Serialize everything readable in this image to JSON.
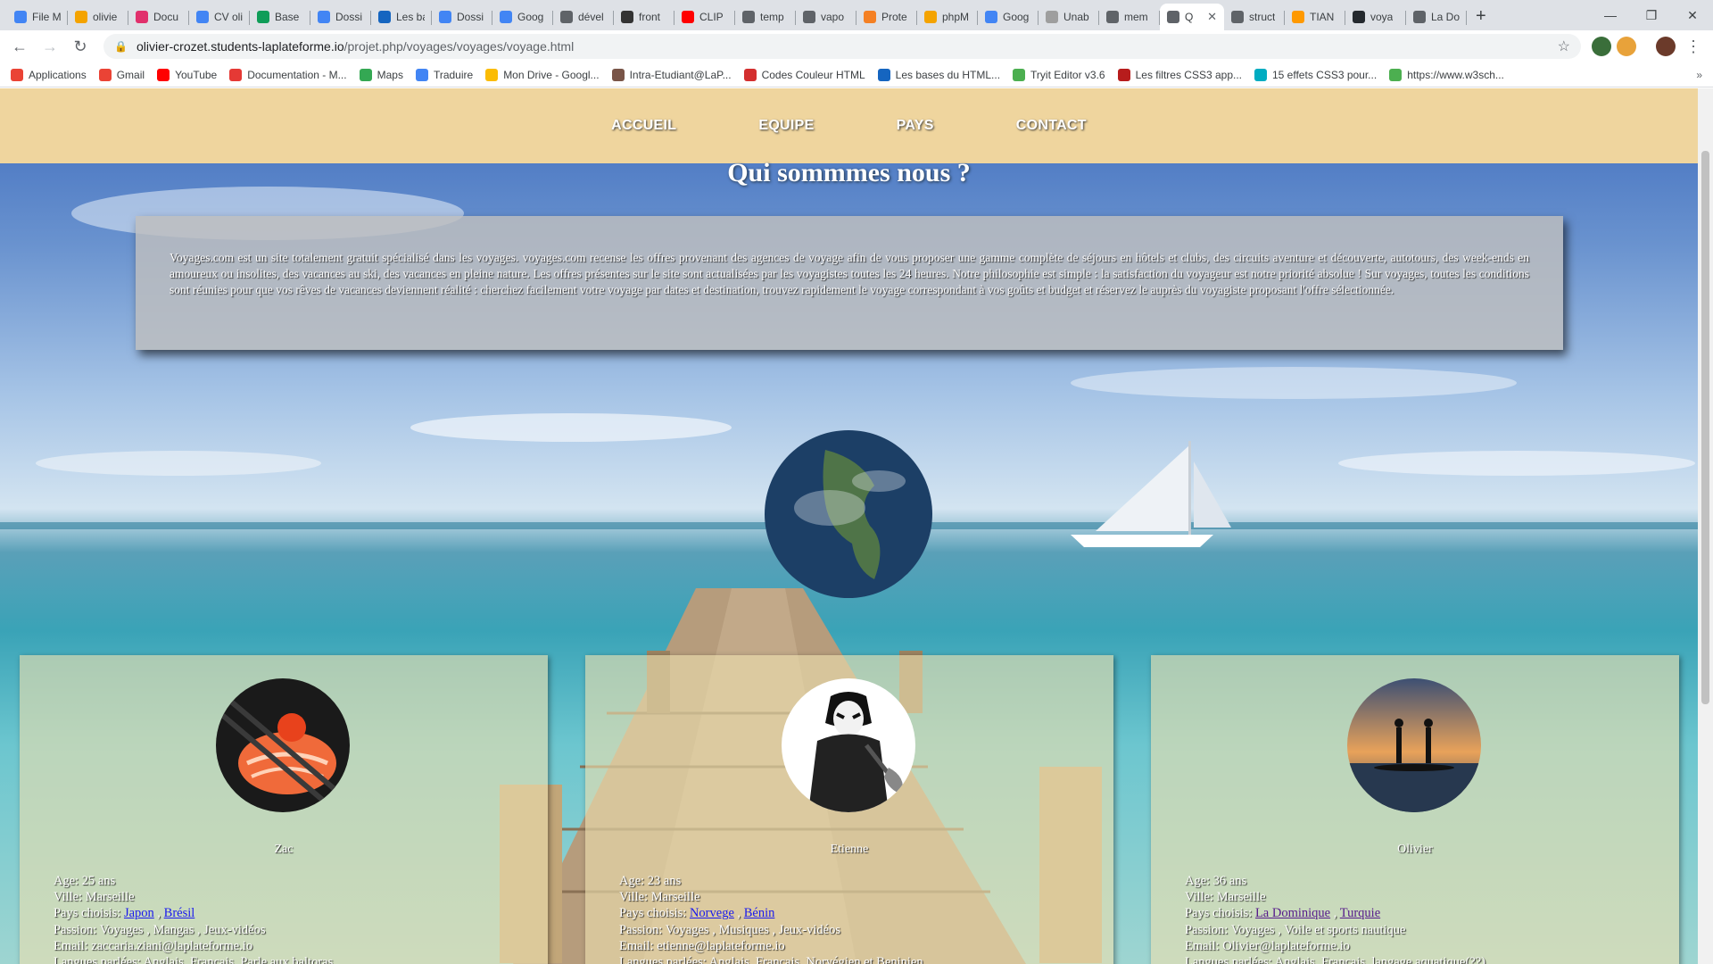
{
  "browser": {
    "tabs": [
      {
        "title": "File M",
        "color": "#4285f4"
      },
      {
        "title": "olivie",
        "color": "#f4a300"
      },
      {
        "title": "Docu",
        "color": "#e1306c"
      },
      {
        "title": "CV oli",
        "color": "#4285f4"
      },
      {
        "title": "Base",
        "color": "#0f9d58"
      },
      {
        "title": "Dossi",
        "color": "#4285f4"
      },
      {
        "title": "Les ba",
        "color": "#1565c0"
      },
      {
        "title": "Dossi",
        "color": "#4285f4"
      },
      {
        "title": "Goog",
        "color": "#4285f4"
      },
      {
        "title": "dével",
        "color": "#5f6368"
      },
      {
        "title": "front",
        "color": "#333333"
      },
      {
        "title": "CLIP",
        "color": "#ff0000"
      },
      {
        "title": "temp",
        "color": "#5f6368"
      },
      {
        "title": "vapo",
        "color": "#5f6368"
      },
      {
        "title": "Prote",
        "color": "#f48024"
      },
      {
        "title": "phpM",
        "color": "#f4a300"
      },
      {
        "title": "Goog",
        "color": "#4285f4"
      },
      {
        "title": "Unab",
        "color": "#9e9e9e"
      },
      {
        "title": "mem",
        "color": "#5f6368"
      },
      {
        "title": "Q",
        "color": "#5f6368",
        "active": true
      },
      {
        "title": "struct",
        "color": "#5f6368"
      },
      {
        "title": "TIAN",
        "color": "#ff9900"
      },
      {
        "title": "voya",
        "color": "#24292e"
      },
      {
        "title": "La Do",
        "color": "#5f6368"
      }
    ],
    "new_tab": "+",
    "url_host": "olivier-crozet.students-laplateforme.io",
    "url_path": "/projet.php/voyages/voyages/voyage.html",
    "bookmarks": [
      {
        "label": "Applications",
        "color": "#ea4335"
      },
      {
        "label": "Gmail",
        "color": "#ea4335"
      },
      {
        "label": "YouTube",
        "color": "#ff0000"
      },
      {
        "label": "Documentation - M...",
        "color": "#e53935"
      },
      {
        "label": "Maps",
        "color": "#34a853"
      },
      {
        "label": "Traduire",
        "color": "#4285f4"
      },
      {
        "label": "Mon Drive - Googl...",
        "color": "#fbbc04"
      },
      {
        "label": "Intra-Etudiant@LaP...",
        "color": "#795548"
      },
      {
        "label": "Codes Couleur HTML",
        "color": "#d32f2f"
      },
      {
        "label": "Les bases du HTML...",
        "color": "#1565c0"
      },
      {
        "label": "Tryit Editor v3.6",
        "color": "#4caf50"
      },
      {
        "label": "Les filtres CSS3 app...",
        "color": "#b71c1c"
      },
      {
        "label": "15 effets CSS3 pour...",
        "color": "#00acc1"
      },
      {
        "label": "https://www.w3sch...",
        "color": "#4caf50"
      }
    ]
  },
  "nav": {
    "home": "ACCUEIL",
    "team": "EQUIPE",
    "countries": "PAYS",
    "contact": "CONTACT"
  },
  "page": {
    "title": "Qui sommmes nous ?",
    "about": "Voyages.com est un site totalement gratuit spécialisé dans les voyages. voyages.com recense les offres provenant des agences de voyage afin de vous proposer une gamme complète de séjours en hôtels et clubs, des circuits aventure et découverte, autotours, des week-ends en amoureux ou insolites, des vacances au ski, des vacances en pleine nature. Les offres présentes sur le site sont actualisées par les voyagistes toutes les 24 heures. Notre philosophie est simple : la satisfaction du voyageur est notre priorité absolue ! Sur voyages, toutes les conditions sont réunies pour que vos rêves de vacances deviennent réalité : cherchez facilement votre voyage par dates et destination, trouvez rapidement le voyage correspondant à vos goûts et budget et réservez le auprès du voyagiste proposant l'offre sélectionnée."
  },
  "members": [
    {
      "name": "Zac",
      "age": "Age: 25 ans",
      "city": "Ville: Marseille",
      "countries_label": "Pays choisis:",
      "country1": "Japon",
      "country2": "Brésil",
      "passion": "Passion: Voyages , Mangas , Jeux-vidéos",
      "email": "Email: zaccaria.ziani@laplateforme.io",
      "languages": "Langues parlées: Anglais, Français, Parle aux baltoras"
    },
    {
      "name": "Etienne",
      "age": "Age: 23 ans",
      "city": "Ville: Marseille",
      "countries_label": "Pays choisis:",
      "country1": "Norvege",
      "country2": "Bénin",
      "passion": "Passion: Voyages , Musiques , Jeux-vidéos",
      "email": "Email: etienne@laplateforme.io",
      "languages": "Langues parlées: Anglais, Français, Norvégien et Beninien"
    },
    {
      "name": "Olivier",
      "age": "Age: 36 ans",
      "city": "Ville: Marseille",
      "countries_label": "Pays choisis:",
      "country1": "La Dominique",
      "country2": "Turquie",
      "passion": "Passion: Voyages , Voile et sports nautique",
      "email": "Email: Olivier@laplateforme.io",
      "languages": "Langues parlées: Anglais, Français, langage aquatique(??)"
    }
  ]
}
